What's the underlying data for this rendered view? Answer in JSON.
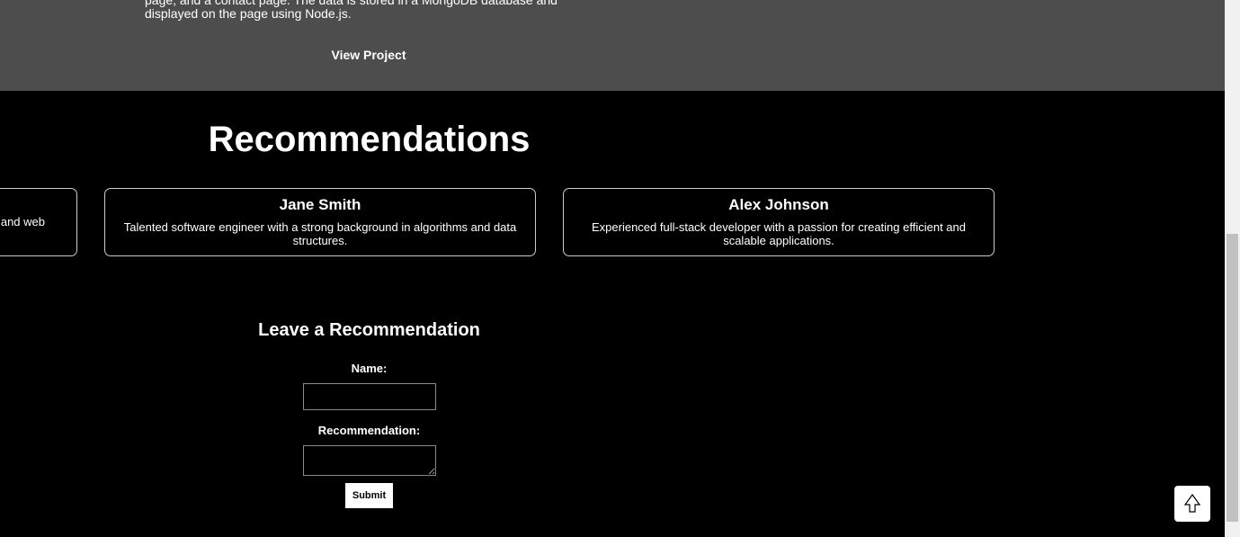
{
  "project": {
    "description": "page, and a contact page. The data is stored in a MongoDB database and displayed on the page using Node.js.",
    "view_project_label": "View Project"
  },
  "recommendations": {
    "title": "Recommendations",
    "cards": [
      {
        "name": "",
        "text": "and web"
      },
      {
        "name": "Jane Smith",
        "text": "Talented software engineer with a strong background in algorithms and data structures."
      },
      {
        "name": "Alex Johnson",
        "text": "Experienced full-stack developer with a passion for creating efficient and scalable applications."
      }
    ]
  },
  "form": {
    "title": "Leave a Recommendation",
    "name_label": "Name:",
    "name_value": "",
    "recommendation_label": "Recommendation:",
    "recommendation_value": "",
    "submit_label": "Submit"
  },
  "back_to_top": {
    "icon": "arrow-up-icon"
  },
  "colors": {
    "background": "#000000",
    "project_band": "#4d4d4d",
    "text": "#ffffff",
    "card_border": "#cccccc"
  }
}
